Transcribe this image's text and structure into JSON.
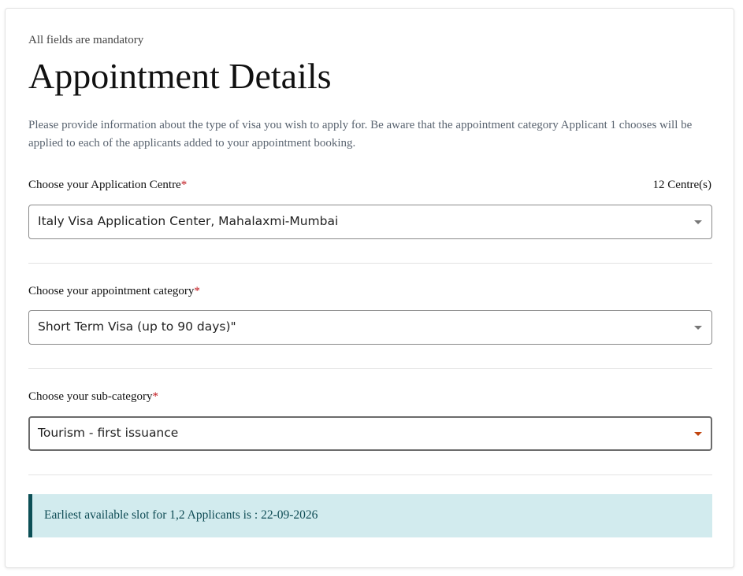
{
  "form": {
    "mandatory_note": "All fields are mandatory",
    "title": "Appointment Details",
    "intro": "Please provide information about the type of visa you wish to apply for. Be aware that the appointment category Applicant 1 chooses will be applied to each of the applicants added to your appointment booking.",
    "required_marker": "*"
  },
  "centre": {
    "label": "Choose your Application Centre",
    "count": "12 Centre(s)",
    "value": "Italy Visa Application Center, Mahalaxmi-Mumbai"
  },
  "category": {
    "label": "Choose your appointment category",
    "value": "Short Term Visa (up to 90 days)\""
  },
  "subcategory": {
    "label": "Choose your sub-category",
    "value": "Tourism - first issuance"
  },
  "alert": {
    "text": "Earliest available slot for 1,2 Applicants is : 22-09-2026"
  },
  "colors": {
    "alert_background": "#d2ebee",
    "alert_border": "#0c4f56",
    "required_star": "#c0161c",
    "active_caret": "#c1440e"
  }
}
